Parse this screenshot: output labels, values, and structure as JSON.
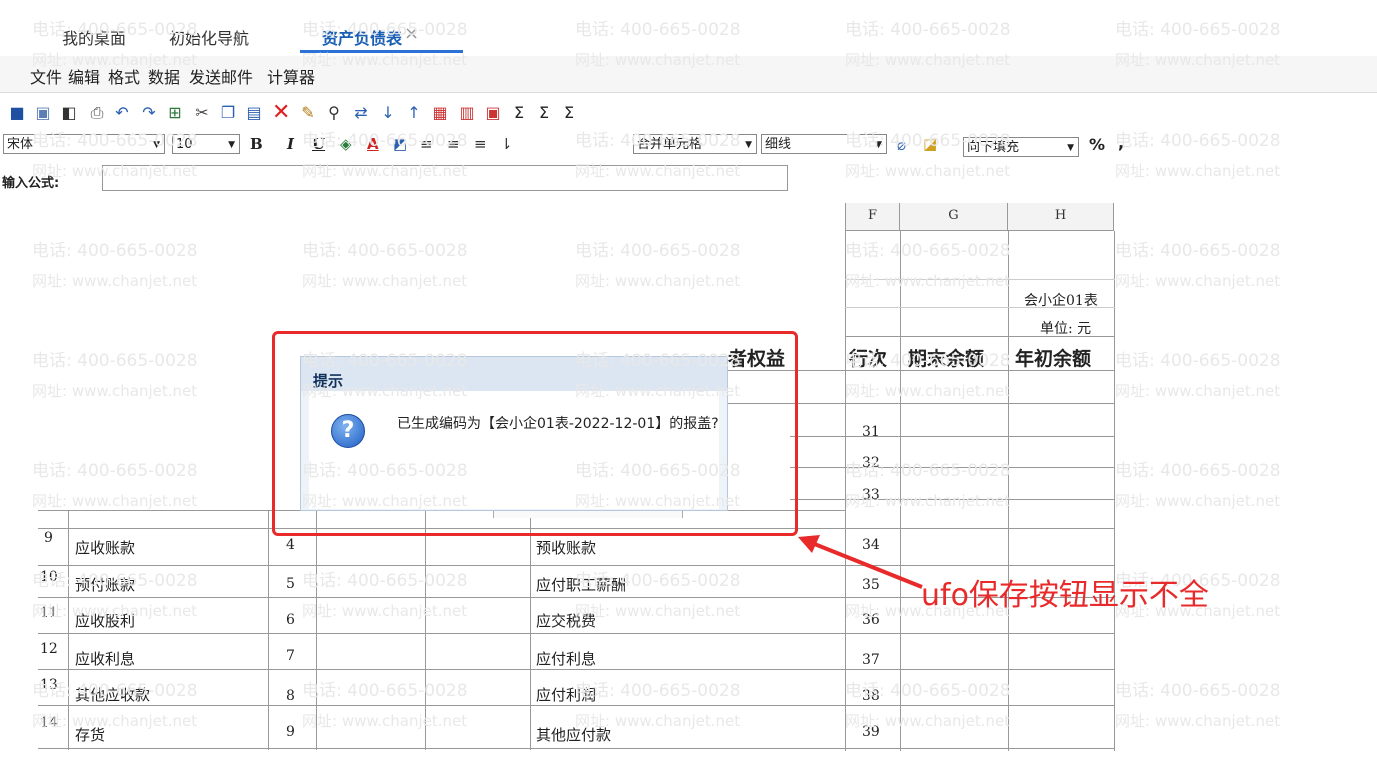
{
  "tabs": [
    {
      "label": "我的桌面"
    },
    {
      "label": "初始化导航"
    },
    {
      "label": "资产负债表",
      "active": true
    }
  ],
  "tab_close": "×",
  "menu": [
    "文件",
    "编辑",
    "格式",
    "数据",
    "发送邮件",
    "计算器"
  ],
  "toolbar": {
    "font_name": "宋体",
    "font_size": "10",
    "bold": "B",
    "italic": "I",
    "underline": "U",
    "merge_cells": "合并单元格",
    "line_style": "细线",
    "fill_down": "向下填充",
    "percent": "%",
    "comma": ","
  },
  "formula_label": "输入公式:",
  "watermark": {
    "phone": "电话: 400-665-0028",
    "site": "网址: www.chanjet.net"
  },
  "columns": [
    "F",
    "G",
    "H"
  ],
  "report": {
    "table_code": "会小企01表",
    "unit": "单位: 元",
    "header_partial": "者权益",
    "header_row": "行次",
    "header_end": "期末余额",
    "header_begin": "年初余额"
  },
  "right_rows": [
    "31",
    "32",
    "33",
    "34",
    "35",
    "36",
    "37",
    "38",
    "39"
  ],
  "left_rows": [
    {
      "n": "9",
      "name": "应收账款",
      "line": "4",
      "liab": "预收账款"
    },
    {
      "n": "10",
      "name": "预付账款",
      "line": "5",
      "liab": "应付职工薪酬"
    },
    {
      "n": "11",
      "name": "应收股利",
      "line": "6",
      "liab": "应交税费"
    },
    {
      "n": "12",
      "name": "应收利息",
      "line": "7",
      "liab": "应付利息"
    },
    {
      "n": "13",
      "name": "其他应收款",
      "line": "8",
      "liab": "应付利润"
    },
    {
      "n": "14",
      "name": "存货",
      "line": "9",
      "liab": "其他应付款"
    }
  ],
  "dialog": {
    "title": "提示",
    "message": "已生成编码为【会小企01表-2022-12-01】的报盖?"
  },
  "annotation": "ufo保存按钮显示不全",
  "colors": {
    "accent": "#2a72d6",
    "annotation_red": "#e82a2a"
  }
}
